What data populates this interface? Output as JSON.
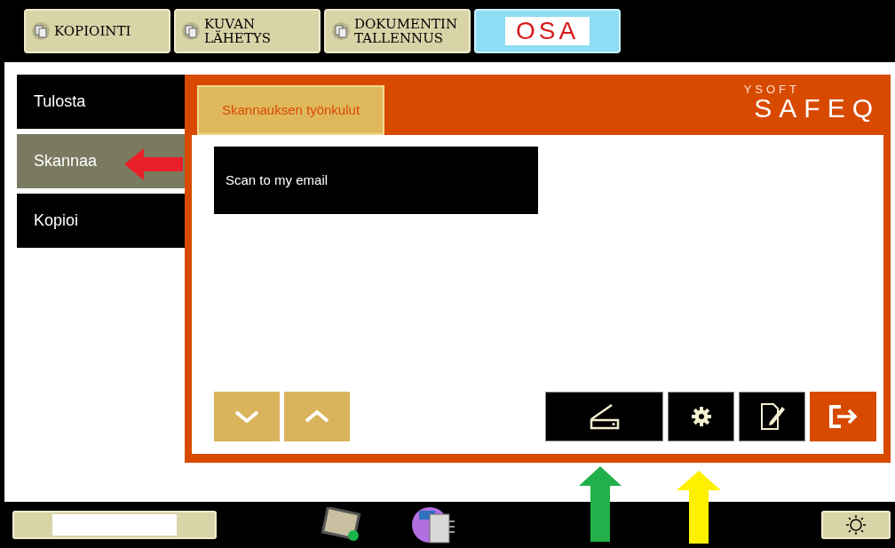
{
  "mode_tabs": [
    {
      "label": "KOPIOINTI",
      "kind": "text",
      "selected": false
    },
    {
      "label": "KUVAN\nLÄHETYS",
      "kind": "text",
      "selected": false
    },
    {
      "label": "DOKUMENTIN\nTALLENNUS",
      "kind": "text",
      "selected": false
    },
    {
      "label": "OSA",
      "kind": "logo",
      "selected": true
    }
  ],
  "sidebar": {
    "items": [
      {
        "label": "Tulosta",
        "selected": false
      },
      {
        "label": "Skannaa",
        "selected": true
      },
      {
        "label": "Kopioi",
        "selected": false
      }
    ]
  },
  "panel": {
    "brand_top": "YSOFT",
    "brand": "SAFEQ",
    "tab": {
      "label": "Skannauksen työnkulut",
      "selected": true
    },
    "workflows": [
      {
        "label": "Scan to my email"
      }
    ],
    "toolbar": [
      {
        "kind": "down"
      },
      {
        "kind": "up"
      },
      {
        "kind": "scan"
      },
      {
        "kind": "settings"
      },
      {
        "kind": "edit"
      },
      {
        "kind": "logout"
      }
    ]
  }
}
